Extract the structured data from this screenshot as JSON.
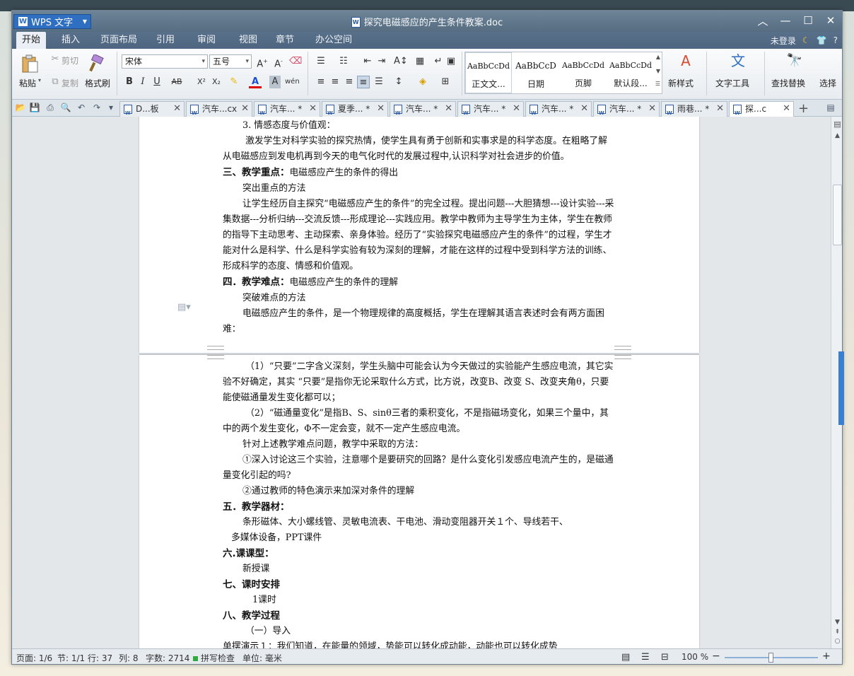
{
  "app": {
    "name": "WPS 文字",
    "doc_title": "探究电磁感应的产生条件教案.doc"
  },
  "menu": {
    "tabs": [
      "开始",
      "插入",
      "页面布局",
      "引用",
      "审阅",
      "视图",
      "章节",
      "办公空间"
    ],
    "active_tab": "开始",
    "login": "未登录",
    "help": "?"
  },
  "ribbon": {
    "paste": "粘贴",
    "cut": "剪切",
    "copy": "复制",
    "format_painter": "格式刷",
    "font_name": "宋体",
    "font_size": "五号",
    "styles": [
      "正文文...",
      "日期",
      "页脚",
      "默认段..."
    ],
    "style_samples": [
      "AaBbCcDd",
      "AaBbCcD",
      "AaBbCcDd",
      "AaBbCcDd"
    ],
    "new_style": "新样式",
    "text_tools": "文字工具",
    "find_replace": "查找替换",
    "select": "选择"
  },
  "doc_tabs": [
    {
      "label": "D...板",
      "active": false
    },
    {
      "label": "汽车...cx",
      "active": false
    },
    {
      "label": "汽车... *",
      "active": false
    },
    {
      "label": "夏季... *",
      "active": false
    },
    {
      "label": "汽车... *",
      "active": false
    },
    {
      "label": "汽车... *",
      "active": false
    },
    {
      "label": "汽车... *",
      "active": false
    },
    {
      "label": "汽车... *",
      "active": false
    },
    {
      "label": "雨巷... *",
      "active": false
    },
    {
      "label": "探...c",
      "active": true
    }
  ],
  "page1": {
    "lines": [
      "3. 情感态度与价值观：",
      " 激发学生对科学实验的探究热情，使学生具有勇于创新和实事求是的科学态度。在粗略了解从电磁感应到发电机再到今天的电气化时代的发展过程中,认识科学对社会进步的价值。",
      "三、教学重点：",
      "电磁感应产生的条件的得出",
      "突出重点的方法",
      "让学生经历自主探究“电磁感应产生的条件”的完全过程。提出问题---大胆猜想---设计实验---采集数据---分析归纳---交流反馈---形成理论---实践应用。教学中教师为主导学生为主体，学生在教师的指导下主动思考、主动探索、亲身体验。经历了“实验探究电磁感应产生的条件”的过程，学生才能对什么是科学、什么是科学实验有较为深刻的理解，才能在这样的过程中受到科学方法的训练、形成科学的态度、情感和价值观。",
      "四．教学难点：",
      "电磁感应产生的条件的理解",
      "突破难点的方法",
      "电磁感应产生的条件，是一个物理规律的高度概括，学生在理解其语言表述时会有两方面困难："
    ]
  },
  "page2": {
    "lines": [
      " （1）“只要”二字含义深刻，学生头脑中可能会认为今天做过的实验能产生感应电流，其它实验不好确定，其实 “只要”是指你无论采取什么方式，比方说，改变B、改变 S、改变夹角θ，只要能使磁通量发生变化都可以；",
      " （2）“磁通量变化”是指B、S、sinθ三者的乘积变化，不是指磁场变化，如果三个量中，其中的两个发生变化，Φ不一定会变，就不一定产生感应电流。",
      "针对上述教学难点问题，教学中采取的方法：",
      "①深入讨论这三个实验，注意哪个是要研究的回路？是什么变化引发感应电流产生的，是磁通量变化引起的吗?",
      "②通过教师的特色演示来加深对条件的理解",
      "五．教学器材：",
      "条形磁体、大小螺线管、灵敏电流表、干电池、滑动变阻器开关１个、导线若干、",
      "多媒体设备，PPT课件",
      "六.课课型：",
      "新授课",
      "七、课时安排",
      "1课时",
      "八、教学过程",
      "（一）导入",
      "单摆演示１：我们知道，在能量的领域，势能可以转化成动能，动能也可以转化成势"
    ]
  },
  "status": {
    "page": "页面: 1/6",
    "section": "节: 1/1",
    "row": "行: 37",
    "col": "列: 8",
    "word_count": "字数: 2714",
    "spell": "拼写检查",
    "unit": "单位: 毫米",
    "zoom": "100 %",
    "zoom_level": 0.5
  },
  "icons": [
    "wps-logo-icon",
    "doc-icon",
    "minimize-icon",
    "maximize-icon",
    "close-icon",
    "paste-icon",
    "cut-icon",
    "copy-icon",
    "format-painter-icon",
    "bold-icon",
    "italic-icon",
    "underline-icon",
    "bullet-list-icon",
    "numbered-list-icon",
    "new-style-icon",
    "text-tools-icon",
    "find-replace-icon",
    "open-icon",
    "save-icon",
    "print-icon",
    "undo-icon",
    "redo-icon",
    "add-tab-icon",
    "page-layout-icon"
  ],
  "colors": {
    "accent": "#2f6fc2",
    "titlebar": "#5d7489",
    "spell_ok": "#2faa3e"
  }
}
